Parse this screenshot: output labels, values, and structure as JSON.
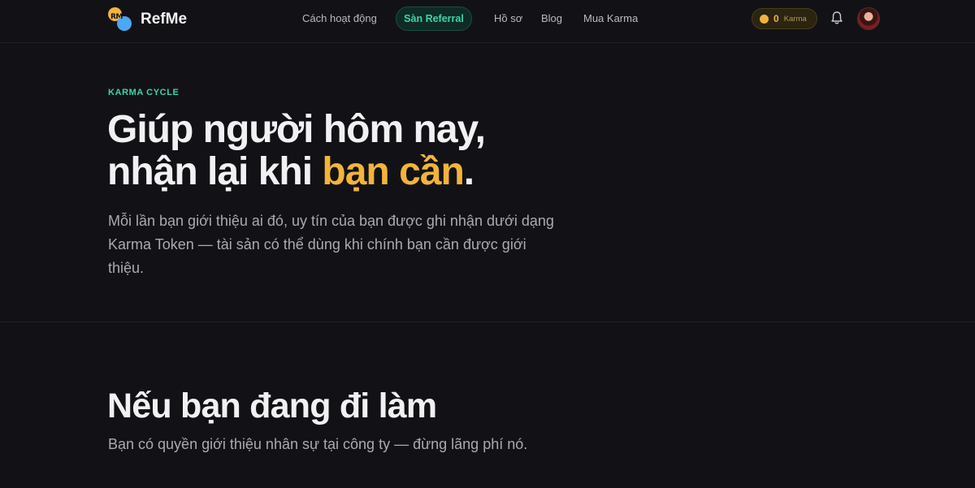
{
  "nav": {
    "logo_mark_text": "RM",
    "logo_name": "RefMe",
    "links": [
      "Cách hoạt động",
      "Sàn Referral",
      "Hồ sơ",
      "Blog",
      "Mua Karma"
    ],
    "karma_count": "0",
    "karma_label": "Karma",
    "icons": {
      "bell": "bell-icon",
      "coin": "coin-icon",
      "avatar": "user-avatar"
    }
  },
  "hero": {
    "eyebrow": "KARMA CYCLE",
    "headline_line1": "Giúp người hôm nay,",
    "headline_line2_prefix": "nhận lại khi ",
    "headline_line2_accent": "bạn cần",
    "headline_line2_suffix": ".",
    "lead": "Mỗi lần bạn giới thiệu ai đó, uy tín của bạn được ghi nhận dưới dạng Karma Token — tài sản có thể dùng khi chính bạn cần được giới thiệu."
  },
  "section2": {
    "title": "Nếu bạn đang đi làm",
    "subtitle": "Bạn có quyền giới thiệu nhân sự tại công ty — đừng lãng phí nó."
  },
  "colors": {
    "background": "#121216",
    "accent_green": "#3fd3a6",
    "accent_gold": "#f2b43a"
  }
}
